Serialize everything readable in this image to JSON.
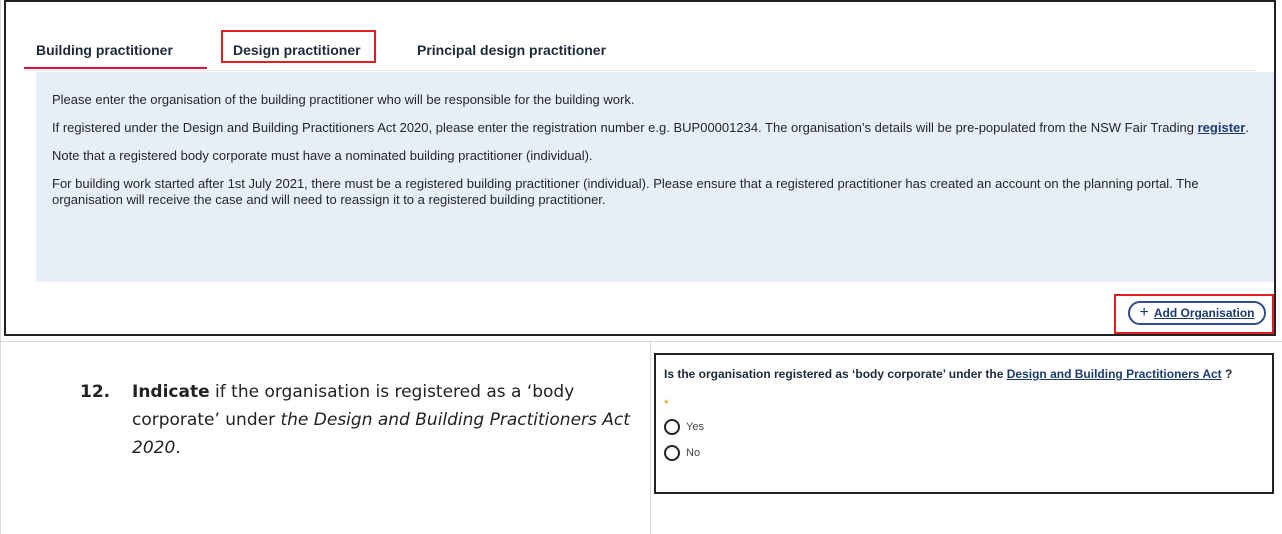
{
  "tabs": [
    {
      "label": "Building practitioner",
      "active": true
    },
    {
      "label": "Design practitioner",
      "highlighted": true
    },
    {
      "label": "Principal design practitioner"
    }
  ],
  "info": {
    "p1": "Please enter the organisation of the building practitioner who will be responsible for the building work.",
    "p2_pre": "If registered under the Design and Building Practitioners Act 2020, please enter the registration number e.g. BUP00001234. The organisation’s details will be pre-populated from the NSW Fair Trading ",
    "p2_link": "register",
    "p2_post": ".",
    "p3": "Note that a registered body corporate must have a nominated building practitioner (individual).",
    "p4": "For building work started after 1st July 2021, there must be a registered building practitioner (individual). Please ensure that a registered practitioner has created an account on the planning portal. The organisation will receive the case and will need to reassign it to a registered building practitioner."
  },
  "add_button": {
    "icon": "+",
    "label": "Add Organisation"
  },
  "instruction": {
    "number": "12.",
    "bold": "Indicate",
    "text_pre": " if the organisation is registered as a ‘body corporate’ under ",
    "italic": "the Design and Building Practitioners Act 2020",
    "text_post": "."
  },
  "question": {
    "text_pre": "Is the organisation registered as ‘body corporate’ under the ",
    "link": "Design and Building Practitioners Act",
    "text_post": " ?",
    "required_mark": "*",
    "options": [
      "Yes",
      "No"
    ]
  },
  "colors": {
    "active_tab_underline": "#d7153a",
    "highlight_red": "#e02020",
    "info_bg": "#e8eef8",
    "link_blue": "#1a3c70",
    "required_orange": "#e08a00"
  }
}
